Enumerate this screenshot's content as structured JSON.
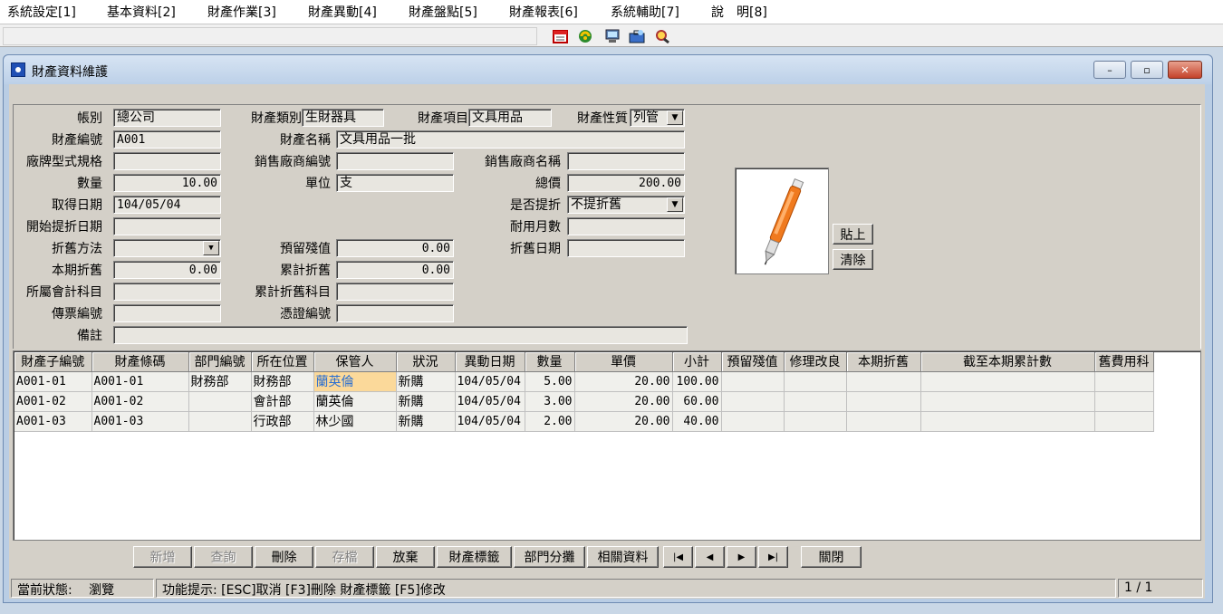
{
  "menubar": {
    "items": [
      "系統設定[1]",
      "基本資料[2]",
      "財產作業[3]",
      "財產異動[4]",
      "財產盤點[5]",
      "財產報表[6]",
      "系統輔助[7]",
      "說　明[8]"
    ]
  },
  "toolbar": {
    "icons": [
      "calendar-icon",
      "recycle-icon",
      "computer-icon",
      "toolbox-icon",
      "search-icon"
    ]
  },
  "window": {
    "title": "財產資料維護",
    "minimize": "–",
    "maximize": "▫",
    "close": "✕"
  },
  "form": {
    "account_label": "帳別",
    "account_value": "總公司",
    "asset_category_label": "財產類別",
    "asset_category_value": "生財器具",
    "asset_item_label": "財產項目",
    "asset_item_value": "文具用品",
    "asset_nature_label": "財產性質",
    "asset_nature_value": "列管",
    "asset_no_label": "財產編號",
    "asset_no_value": "A001",
    "asset_name_label": "財產名稱",
    "asset_name_value": "文具用品一批",
    "brand_spec_label": "廠牌型式規格",
    "brand_spec_value": "",
    "vendor_no_label": "銷售廠商編號",
    "vendor_no_value": "",
    "vendor_name_label": "銷售廠商名稱",
    "vendor_name_value": "",
    "quantity_label": "數量",
    "quantity_value": "10.00",
    "unit_label": "單位",
    "unit_value": "支",
    "total_price_label": "總價",
    "total_price_value": "200.00",
    "acquire_date_label": "取得日期",
    "acquire_date_value": "104/05/04",
    "depreciate_flag_label": "是否提折",
    "depreciate_flag_value": "不提折舊",
    "start_depr_date_label": "開始提折日期",
    "start_depr_date_value": "",
    "useful_months_label": "耐用月數",
    "useful_months_value": "",
    "depr_method_label": "折舊方法",
    "depr_method_value": "",
    "residual_label": "預留殘值",
    "residual_value": "0.00",
    "depr_date_label": "折舊日期",
    "depr_date_value": "",
    "period_depr_label": "本期折舊",
    "period_depr_value": "0.00",
    "accum_depr_label": "累計折舊",
    "accum_depr_value": "0.00",
    "account_subject_label": "所屬會計科目",
    "account_subject_value": "",
    "accum_depr_subject_label": "累計折舊科目",
    "accum_depr_subject_value": "",
    "voucher_no_label": "傳票編號",
    "voucher_no_value": "",
    "certificate_no_label": "憑證編號",
    "certificate_no_value": "",
    "remark_label": "備註",
    "remark_value": ""
  },
  "photo": {
    "paste_label": "貼上",
    "clear_label": "清除"
  },
  "grid": {
    "headers": [
      "財產子編號",
      "財產條碼",
      "部門編號",
      "所在位置",
      "保管人",
      "狀況",
      "異動日期",
      "數量",
      "單價",
      "小計",
      "預留殘值",
      "修理改良",
      "本期折舊",
      "截至本期累計數",
      "舊費用科"
    ],
    "rows": [
      [
        "A001-01",
        "A001-01",
        "財務部",
        "財務部",
        "蘭英倫",
        "新購",
        "104/05/04",
        "5.00",
        "20.00",
        "100.00",
        "",
        "",
        "",
        "",
        ""
      ],
      [
        "A001-02",
        "A001-02",
        "",
        "會計部",
        "蘭英倫",
        "新購",
        "104/05/04",
        "3.00",
        "20.00",
        "60.00",
        "",
        "",
        "",
        "",
        ""
      ],
      [
        "A001-03",
        "A001-03",
        "",
        "行政部",
        "林少國",
        "新購",
        "104/05/04",
        "2.00",
        "20.00",
        "40.00",
        "",
        "",
        "",
        "",
        ""
      ]
    ]
  },
  "buttons": {
    "add": "新增",
    "query": "查詢",
    "delete": "刪除",
    "save": "存檔",
    "abandon": "放棄",
    "asset_tag": "財產標籤",
    "dept_split": "部門分攤",
    "related": "相關資料",
    "first": "|◀",
    "prev": "◀",
    "next": "▶",
    "last": "▶|",
    "close": "關閉"
  },
  "status": {
    "state_label": "當前狀態:",
    "state_value": "瀏覽",
    "hint": "功能提示: [ESC]取消 [F3]刪除 財產標籤 [F5]修改",
    "page": "1 / 1"
  }
}
